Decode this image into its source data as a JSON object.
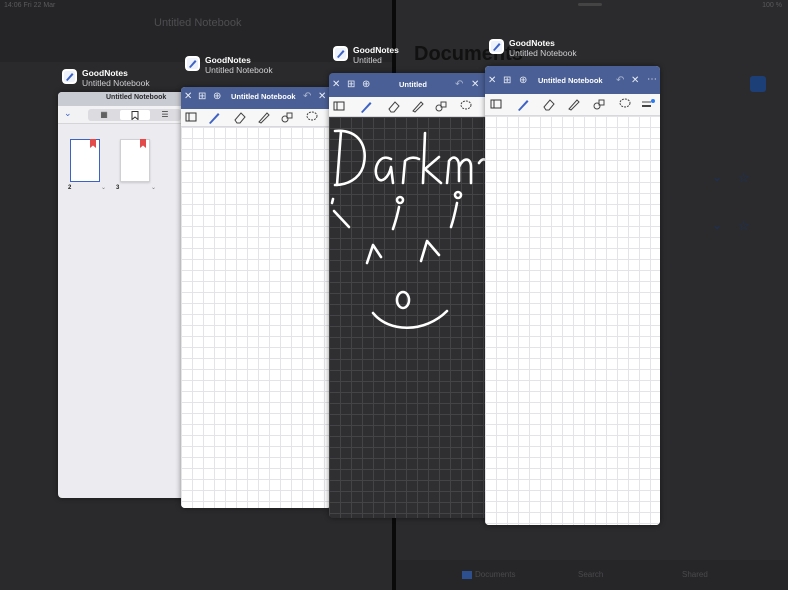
{
  "background": {
    "status_time": "14:06",
    "status_date": "Fri 22 Mar",
    "status_right": "100 %",
    "left_title": "Untitled Notebook",
    "documents_title": "Documents",
    "tab_documents": "Documents",
    "tab_search": "Search",
    "tab_shared": "Shared"
  },
  "cards": [
    {
      "app_name": "GoodNotes",
      "doc_name": "Untitled Notebook",
      "doc_title_bar": "Untitled Notebook",
      "page_numbers": [
        "2",
        "3"
      ]
    },
    {
      "app_name": "GoodNotes",
      "doc_name": "Untitled Notebook",
      "nav_title": "Untitled Notebook"
    },
    {
      "app_name": "GoodNotes",
      "doc_name": "Untitled",
      "nav_title": "Untitled",
      "handwriting": "Darkm"
    },
    {
      "app_name": "GoodNotes",
      "doc_name": "Untitled Notebook",
      "nav_title": "Untitled Notebook"
    }
  ],
  "colors": {
    "nav_bar": "#4a5f95",
    "accent": "#3d62c6",
    "bookmark": "#e34b4b",
    "dark_canvas": "#2f2f31"
  }
}
